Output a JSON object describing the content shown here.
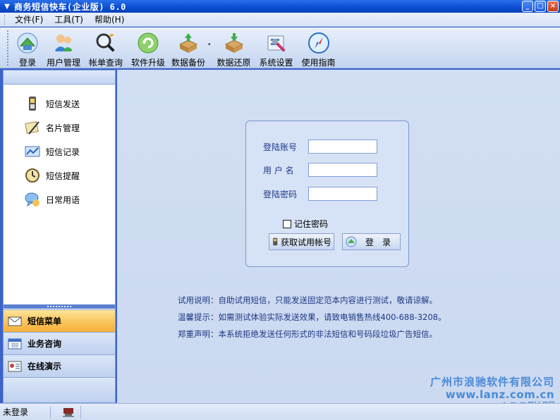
{
  "window": {
    "title": "商务短信快车(企业版) 6.0",
    "controls": [
      "_",
      "□",
      "×"
    ]
  },
  "menu": [
    {
      "label": "文件(F)"
    },
    {
      "label": "工具(T)"
    },
    {
      "label": "帮助(H)"
    }
  ],
  "toolbar": [
    {
      "label": "登录",
      "icon": "login-icon"
    },
    {
      "label": "用户管理",
      "icon": "users-icon"
    },
    {
      "label": "帐单查询",
      "icon": "search-icon"
    },
    {
      "label": "软件升级",
      "icon": "upgrade-icon"
    },
    {
      "label": "数据备份",
      "icon": "backup-icon",
      "dropdown": "▾"
    },
    {
      "label": "数据还原",
      "icon": "restore-icon"
    },
    {
      "label": "系统设置",
      "icon": "settings-icon"
    },
    {
      "label": "使用指南",
      "icon": "compass-icon"
    }
  ],
  "sidebar": {
    "items": [
      {
        "label": "短信发送",
        "icon": "phone-icon"
      },
      {
        "label": "名片管理",
        "icon": "card-pen-icon"
      },
      {
        "label": "短信记录",
        "icon": "records-icon"
      },
      {
        "label": "短信提醒",
        "icon": "clock-icon"
      },
      {
        "label": "日常用语",
        "icon": "chat-icon"
      }
    ],
    "categories": [
      {
        "label": "短信菜单",
        "icon": "mail-icon",
        "active": true
      },
      {
        "label": "业务咨询",
        "icon": "calendar-icon",
        "active": false
      },
      {
        "label": "在线演示",
        "icon": "contact-card-icon",
        "active": false
      }
    ]
  },
  "login": {
    "account_label": "登陆账号",
    "username_label": "用 户 名",
    "password_label": "登陆密码",
    "account_value": "",
    "username_value": "",
    "password_value": "",
    "remember_label": "记住密码",
    "remember_checked": false,
    "trial_button": "获取试用帐号",
    "login_button": "登　录"
  },
  "notes": [
    "试用说明：自助试用短信，只能发送固定范本内容进行测试，敬请谅解。",
    "温馨提示：如需测试体验实际发送效果，请致电销售热线400-688-3208。",
    "郑重声明：本系统拒绝发送任何形式的非法短信和号码段垃圾广告短信。"
  ],
  "watermark": {
    "company": "广州市浪驰软件有限公司",
    "url": "www.lanz.com.cn",
    "arp": "ARP联盟"
  },
  "status": {
    "text": "未登录"
  },
  "colors": {
    "titlebar": "#0b4fd4",
    "accent_active": "#f9c45a",
    "main_bg": "#cbd9f1",
    "note_text": "#1e3780"
  }
}
